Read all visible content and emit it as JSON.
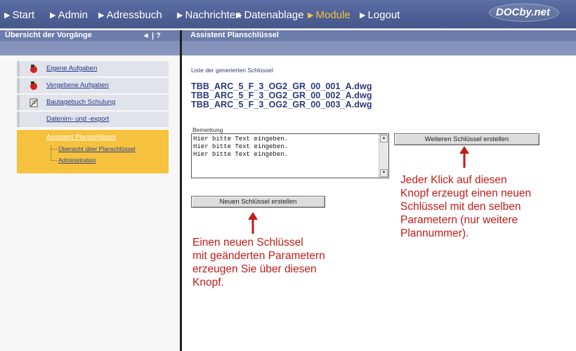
{
  "nav": {
    "items": [
      {
        "label": "Start"
      },
      {
        "label": "Admin"
      },
      {
        "label": "Adressbuch"
      },
      {
        "label": "Nachrichten"
      },
      {
        "label": "Datenablage"
      },
      {
        "label": "Module"
      },
      {
        "label": "Logout"
      }
    ],
    "active_label": "Module",
    "logo": "DOCby.net"
  },
  "left_panel": {
    "title": "Übersicht der Vorgänge",
    "controls": "◄ | ?",
    "menu": [
      {
        "label": "Eigene Aufgaben",
        "icon": "task-icon"
      },
      {
        "label": "Vergebene Aufgaben",
        "icon": "task-icon"
      },
      {
        "label": "Bautagebuch Schulung",
        "icon": "notepad-icon"
      },
      {
        "label": "Datenim- und -export",
        "icon": ""
      },
      {
        "label": "Assistent Planschlüssel",
        "icon": "",
        "active": true
      }
    ],
    "submenu": [
      {
        "label": "Übersicht über Planschlüssel"
      },
      {
        "label": "Administration"
      }
    ]
  },
  "right_panel": {
    "title": "Assistent Planschlüssel",
    "list_heading": "Liste der generierten Schlüssel",
    "keys": [
      "TBB_ARC_5_F_3_OG2_GR_00_001_A.dwg",
      "TBB_ARC_5_F_3_OG2_GR_00_002_A.dwg",
      "TBB_ARC_5_F_3_OG2_GR_00_003_A.dwg"
    ],
    "remark_label": "Bemerkung",
    "remark_value": "Hier bitte Text eingeben.\nHier bitte Text eingeben.\nHier bitte Text eingeben.",
    "button_more": "Weiteren Schlüssel erstellen",
    "button_new": "Neuen Schlüssel erstellen"
  },
  "annotations": {
    "right": [
      "Jeder Klick auf diesen",
      "Knopf erzeugt einen neuen",
      "Schlüssel mit den selben",
      "Parametern (nur weitere",
      "Plannummer)."
    ],
    "left": [
      "Einen neuen Schlüssel",
      "mit geänderten Parametern",
      "erzeugen Sie über diesen",
      "Knopf."
    ]
  },
  "colors": {
    "nav_bg": "#4d5f94",
    "nav_active": "#f3c23b",
    "menu_active": "#f6c23e",
    "annotation": "#c21b17",
    "key_text": "#2a3a7a"
  }
}
